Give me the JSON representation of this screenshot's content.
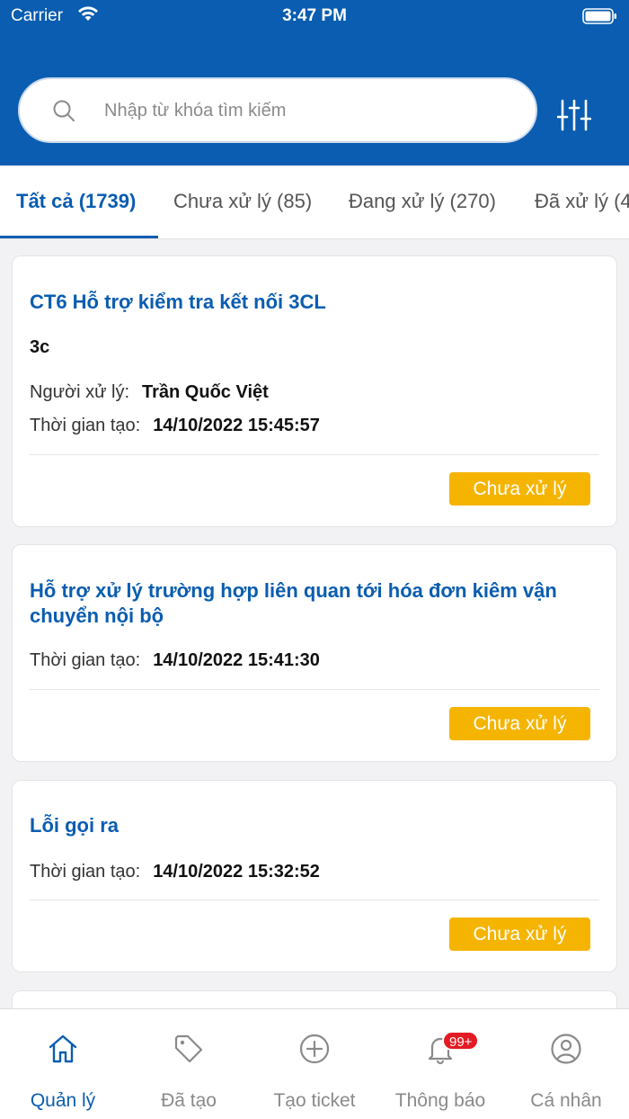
{
  "status_bar": {
    "carrier": "Carrier",
    "time": "3:47 PM"
  },
  "search": {
    "placeholder": "Nhập từ khóa tìm kiếm"
  },
  "tabs": [
    {
      "label": "Tất cả (1739)"
    },
    {
      "label": "Chưa xử lý (85)"
    },
    {
      "label": "Đang xử lý (270)"
    },
    {
      "label": "Đã xử lý (4"
    }
  ],
  "tickets": [
    {
      "title": "CT6 Hỗ trợ kiểm tra kết nối 3CL",
      "subtitle": "3c",
      "handler_label": "Người xử lý:",
      "handler": "Trần Quốc Việt",
      "created_label": "Thời gian tạo:",
      "created": "14/10/2022 15:45:57",
      "status": "Chưa xử lý"
    },
    {
      "title": "Hỗ trợ xử lý trường hợp liên quan tới hóa đơn kiêm vận chuyển nội bộ",
      "created_label": "Thời gian tạo:",
      "created": "14/10/2022 15:41:30",
      "status": "Chưa xử lý"
    },
    {
      "title": "Lỗi gọi ra",
      "created_label": "Thời gian tạo:",
      "created": "14/10/2022 15:32:52",
      "status": "Chưa xử lý"
    }
  ],
  "nav": [
    {
      "label": "Quản lý",
      "icon": "home-icon"
    },
    {
      "label": "Đã tạo",
      "icon": "tag-icon"
    },
    {
      "label": "Tạo ticket",
      "icon": "plus-circle-icon"
    },
    {
      "label": "Thông báo",
      "icon": "bell-icon",
      "badge": "99+"
    },
    {
      "label": "Cá nhân",
      "icon": "user-icon"
    }
  ],
  "colors": {
    "primary": "#0a5db0",
    "status_pending": "#f5b400",
    "badge": "#e31b23"
  }
}
